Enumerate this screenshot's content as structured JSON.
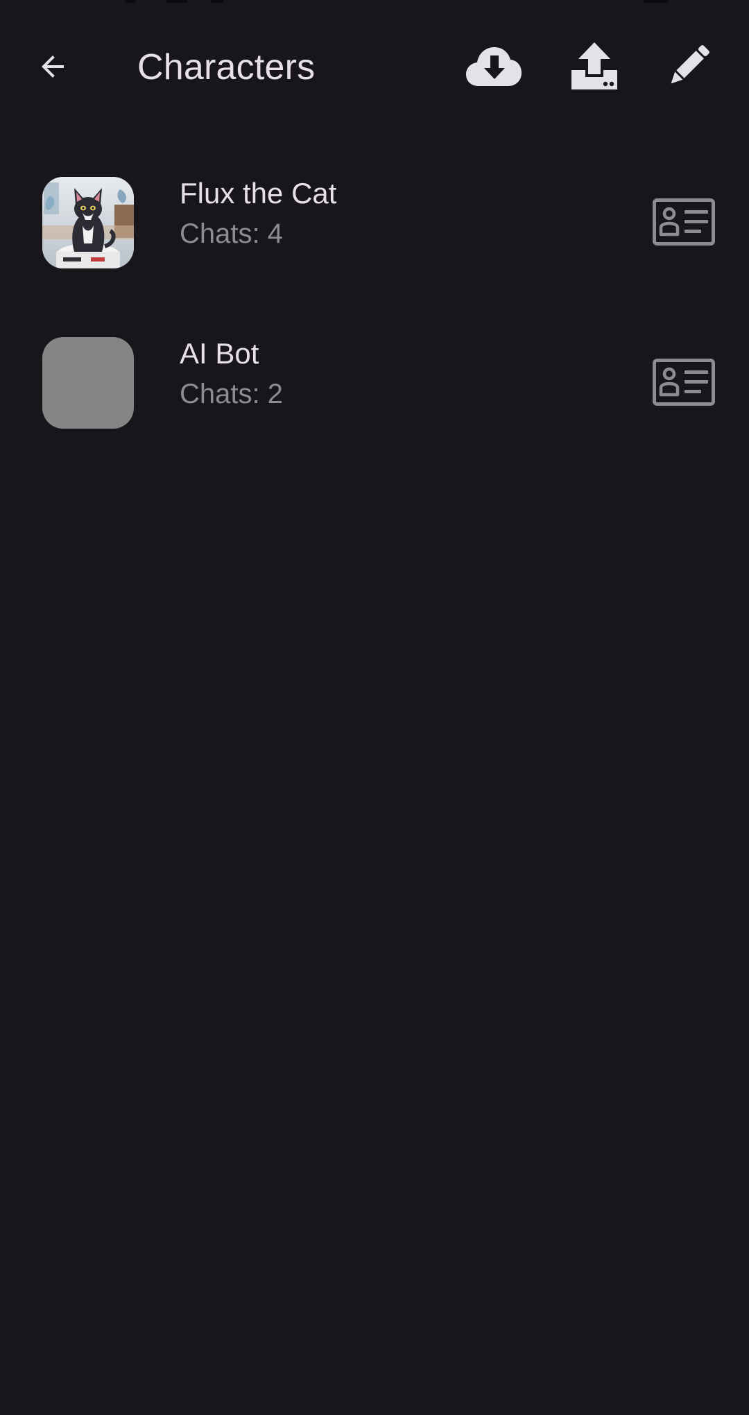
{
  "app_bar": {
    "title": "Characters",
    "icons": {
      "back": "arrow-back-icon",
      "import": "cloud-download-icon",
      "export": "upload-icon",
      "edit": "pencil-icon"
    }
  },
  "characters": [
    {
      "name": "Flux the Cat",
      "chats": "Chats: 4",
      "avatar": "cat-avatar-image",
      "action_icon": "id-card-icon"
    },
    {
      "name": "AI Bot",
      "chats": "Chats: 2",
      "avatar": "placeholder-avatar",
      "action_icon": "id-card-icon"
    }
  ],
  "colors": {
    "background": "#18161b",
    "text_primary": "#e6e1e8",
    "text_secondary": "#8f8b93",
    "icon": "#e4e1e8",
    "card_icon": "#8f8b93",
    "avatar_placeholder": "#858585"
  }
}
